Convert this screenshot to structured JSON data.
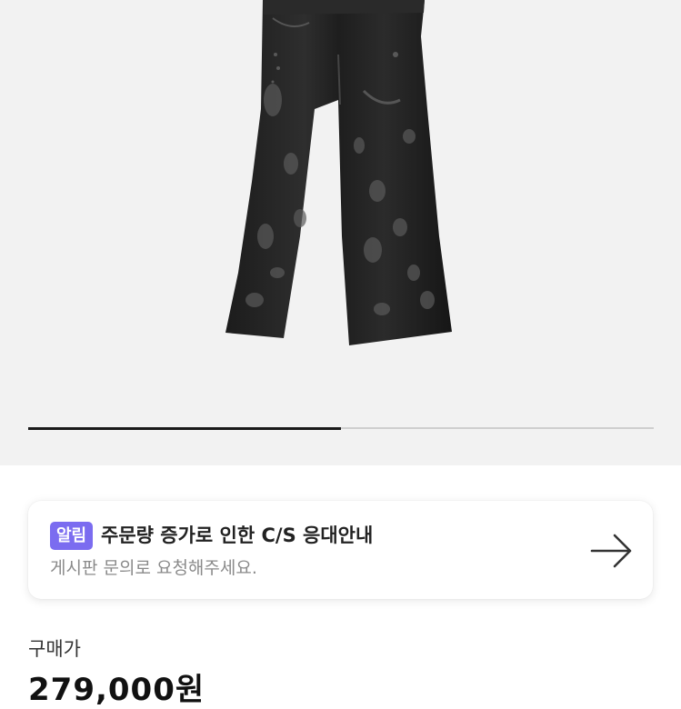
{
  "product": {
    "image_alt": "black distressed flare jeans",
    "gallery_progress_fraction": 0.5
  },
  "notice": {
    "badge": "알림",
    "title": "주문량 증가로 인한 C/S 응대안내",
    "subtitle": "게시판 문의로 요청해주세요.",
    "arrow_icon": "arrow-right-icon",
    "badge_color": "#7b6cf0"
  },
  "price": {
    "label": "구매가",
    "value": "279,000원"
  }
}
